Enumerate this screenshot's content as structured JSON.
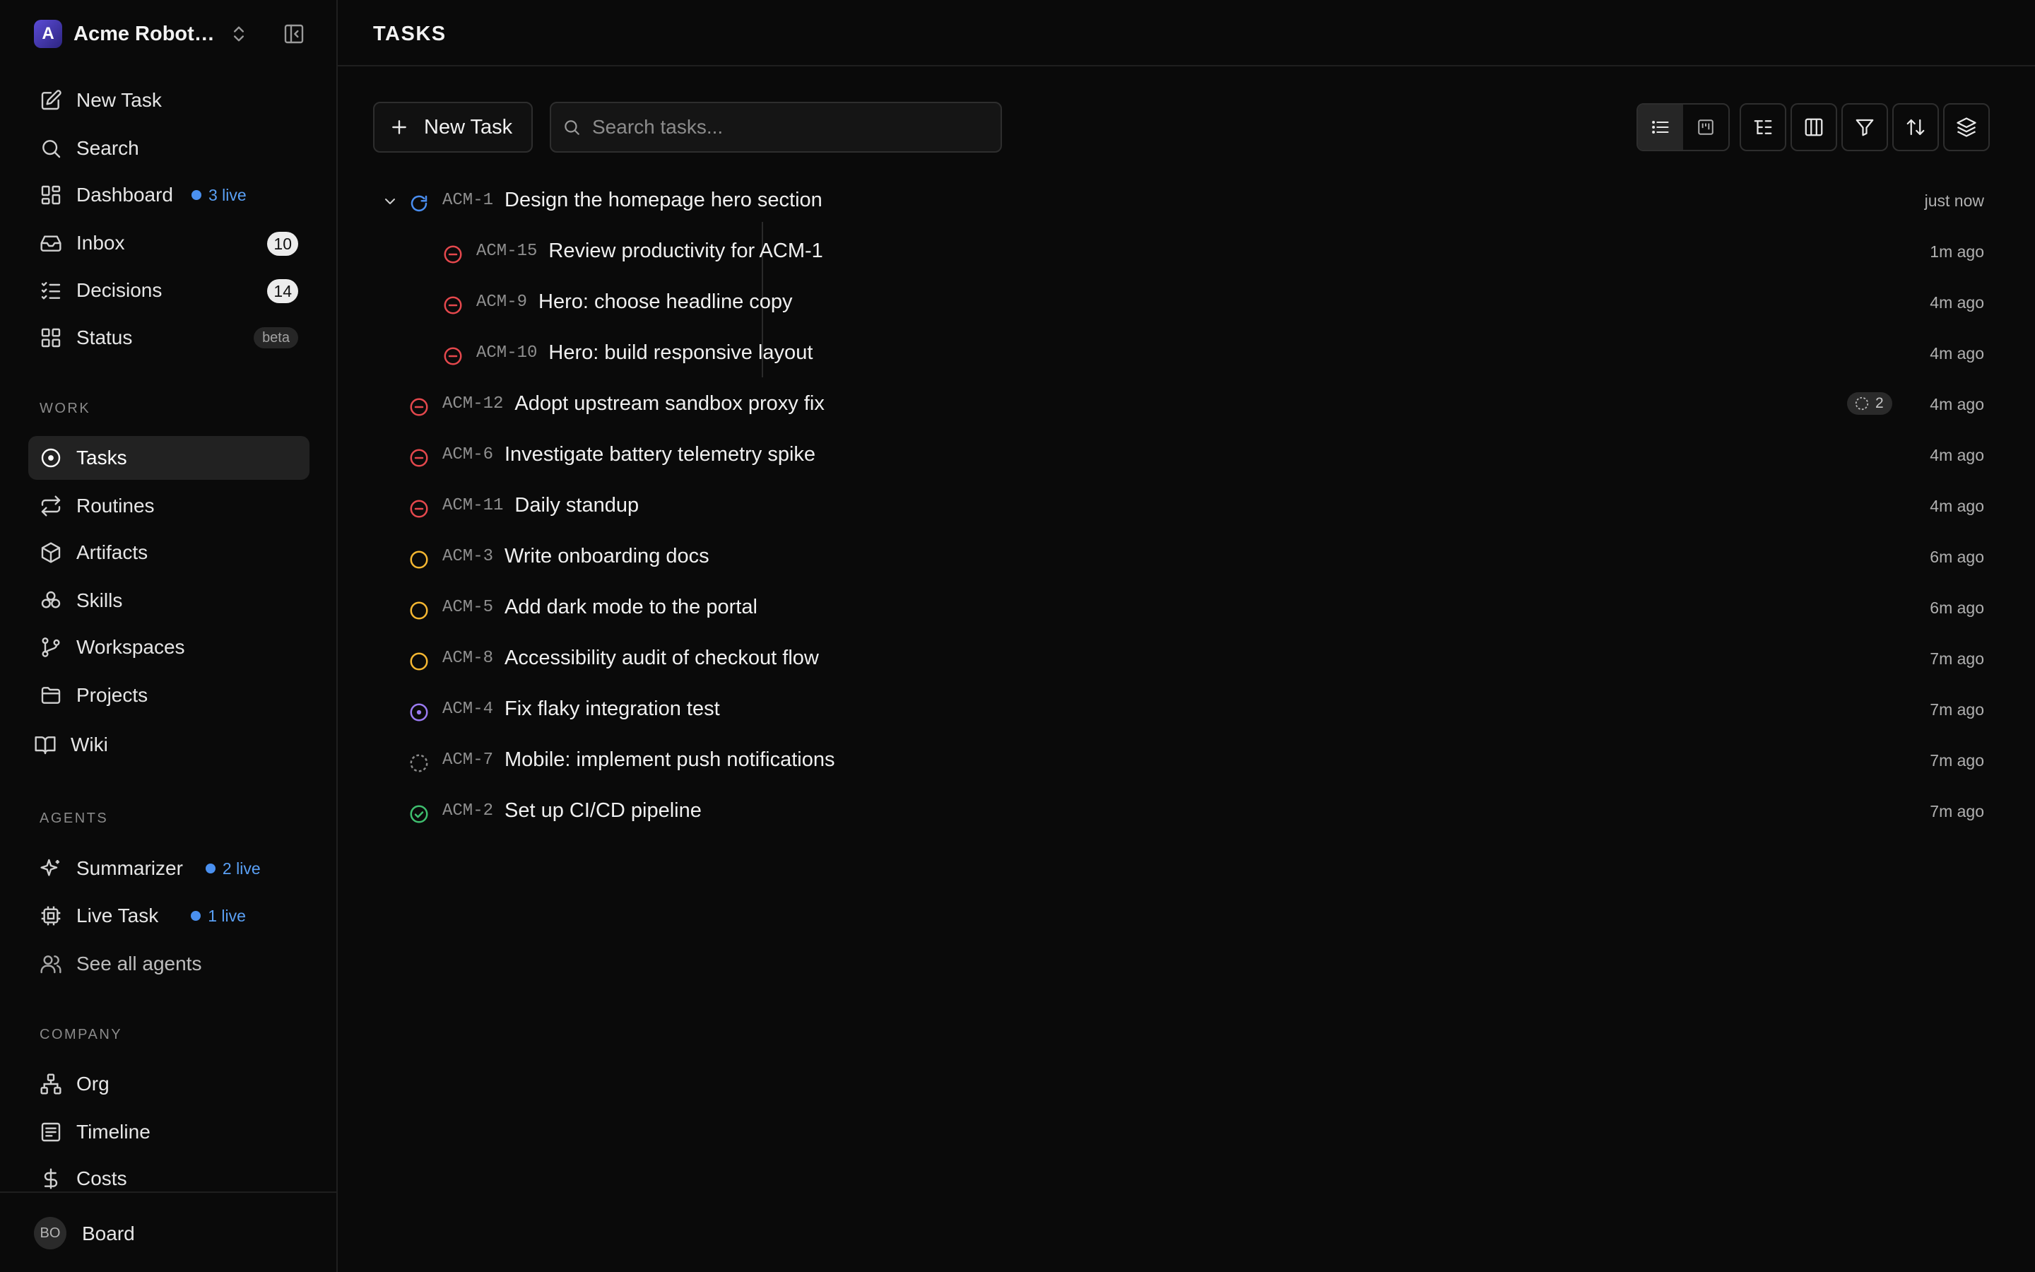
{
  "workspace": {
    "name": "Acme Robotics",
    "initial": "A"
  },
  "nav": {
    "new_task": "New Task",
    "search": "Search",
    "dashboard": "Dashboard",
    "dashboard_live": "3 live",
    "inbox": "Inbox",
    "inbox_count": "10",
    "decisions": "Decisions",
    "decisions_count": "14",
    "status": "Status",
    "status_badge": "beta"
  },
  "sections": {
    "work": "WORK",
    "agents": "AGENTS",
    "company": "COMPANY"
  },
  "work": {
    "tasks": "Tasks",
    "routines": "Routines",
    "artifacts": "Artifacts",
    "skills": "Skills",
    "workspaces": "Workspaces",
    "projects": "Projects",
    "wiki": "Wiki"
  },
  "agents": {
    "summarizer": "Summarizer",
    "summarizer_live": "2 live",
    "live_task": "Live Task",
    "live_task_live": "1 live",
    "see_all": "See all agents"
  },
  "company": {
    "org": "Org",
    "timeline": "Timeline",
    "costs": "Costs"
  },
  "user": {
    "initials": "BO",
    "name": "Board"
  },
  "page": {
    "title": "TASKS",
    "new_task_button": "New Task",
    "search_placeholder": "Search tasks..."
  },
  "colors": {
    "blocked": "#e5484d",
    "todo": "#f5b731",
    "in_progress": "#9b7bf2",
    "running": "#4a8ef0",
    "backlog": "#8a8a8a",
    "done": "#3fbf6f",
    "live_dot": "#4a90f0"
  },
  "tasks": [
    {
      "id": "ACM-1",
      "title": "Design the homepage hero section",
      "time": "just now",
      "status": "running",
      "expanded": true
    },
    {
      "id": "ACM-15",
      "title": "Review productivity for ACM-1",
      "time": "1m ago",
      "status": "blocked",
      "child": true
    },
    {
      "id": "ACM-9",
      "title": "Hero: choose headline copy",
      "time": "4m ago",
      "status": "blocked",
      "child": true
    },
    {
      "id": "ACM-10",
      "title": "Hero: build responsive layout",
      "time": "4m ago",
      "status": "blocked",
      "child": true
    },
    {
      "id": "ACM-12",
      "title": "Adopt upstream sandbox proxy fix",
      "time": "4m ago",
      "status": "blocked",
      "subtasks": "2"
    },
    {
      "id": "ACM-6",
      "title": "Investigate battery telemetry spike",
      "time": "4m ago",
      "status": "blocked"
    },
    {
      "id": "ACM-11",
      "title": "Daily standup",
      "time": "4m ago",
      "status": "blocked"
    },
    {
      "id": "ACM-3",
      "title": "Write onboarding docs",
      "time": "6m ago",
      "status": "todo"
    },
    {
      "id": "ACM-5",
      "title": "Add dark mode to the portal",
      "time": "6m ago",
      "status": "todo"
    },
    {
      "id": "ACM-8",
      "title": "Accessibility audit of checkout flow",
      "time": "7m ago",
      "status": "todo"
    },
    {
      "id": "ACM-4",
      "title": "Fix flaky integration test",
      "time": "7m ago",
      "status": "in_progress"
    },
    {
      "id": "ACM-7",
      "title": "Mobile: implement push notifications",
      "time": "7m ago",
      "status": "backlog"
    },
    {
      "id": "ACM-2",
      "title": "Set up CI/CD pipeline",
      "time": "7m ago",
      "status": "done"
    }
  ]
}
